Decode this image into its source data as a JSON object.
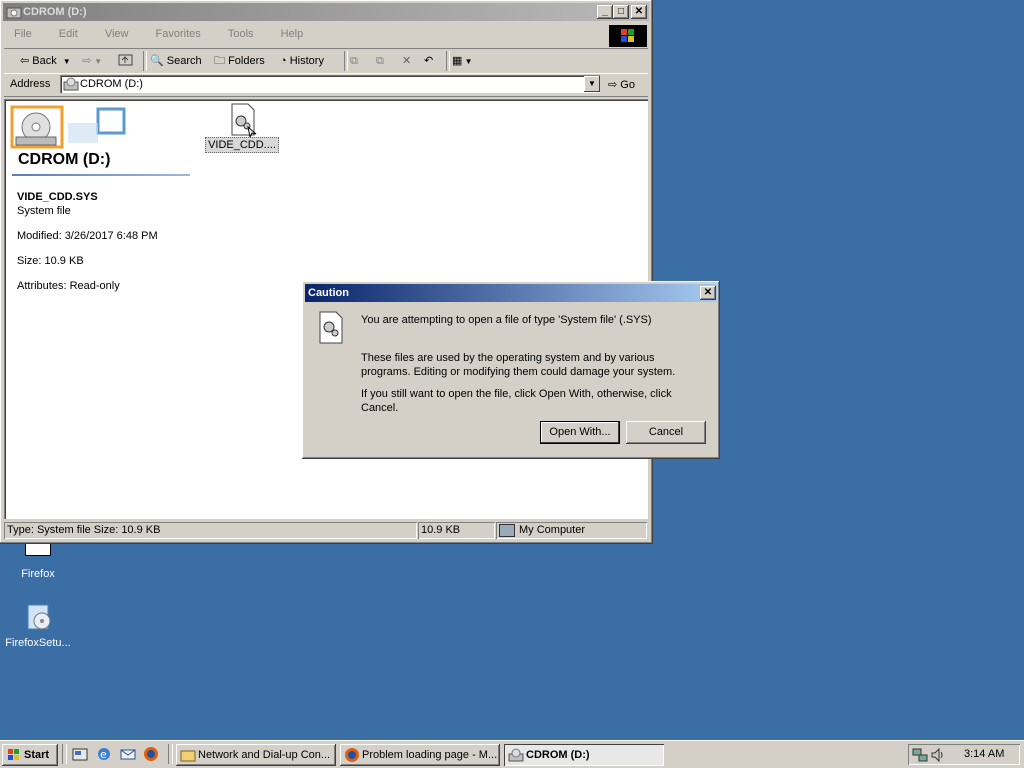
{
  "window": {
    "title": "CDROM (D:)",
    "menu": [
      "File",
      "Edit",
      "View",
      "Favorites",
      "Tools",
      "Help"
    ],
    "toolbar": {
      "back": "Back",
      "search": "Search",
      "folders": "Folders",
      "history": "History"
    },
    "address_label": "Address",
    "address_value": "CDROM (D:)",
    "go_label": "Go",
    "drive_heading": "CDROM (D:)",
    "file_icon_label": "VIDE_CDD....",
    "details": {
      "name": "VIDE_CDD.SYS",
      "type": "System file",
      "modified": "Modified: 3/26/2017 6:48 PM",
      "size": "Size: 10.9 KB",
      "attributes": "Attributes: Read-only"
    },
    "status": {
      "left": "Type: System file Size: 10.9 KB",
      "mid": "10.9 KB",
      "right": "My Computer"
    }
  },
  "desktop_icons": [
    {
      "label": "Firefox"
    },
    {
      "label": "FirefoxSetu..."
    }
  ],
  "dialog": {
    "title": "Caution",
    "line1": "You are attempting to open a file of type 'System file' (.SYS)",
    "line2": "These files are used by the operating system and by various programs. Editing or modifying them could damage your system.",
    "line3": "If you still want to open the file, click Open With, otherwise, click Cancel.",
    "open_with": "Open With...",
    "cancel": "Cancel"
  },
  "taskbar": {
    "start": "Start",
    "tasks": [
      "Network and Dial-up Con...",
      "Problem loading page - M...",
      "CDROM (D:)"
    ],
    "time": "3:14 AM"
  },
  "colors": {
    "desktop": "#3a6ea5",
    "dialog_title": "#0a246a",
    "face": "#d4d0c8"
  }
}
